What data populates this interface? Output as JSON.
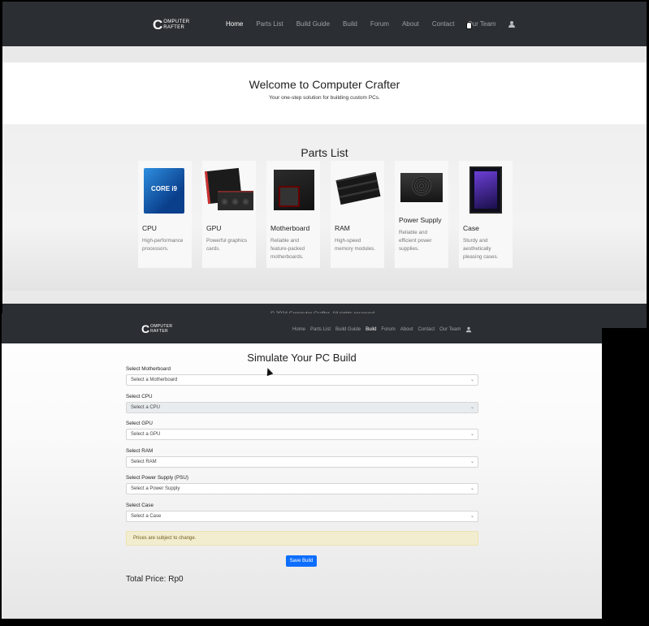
{
  "top": {
    "logo": {
      "big": "C",
      "line1": "OMPUTER",
      "line2": "RAFTER"
    },
    "nav": [
      "Home",
      "Parts List",
      "Build Guide",
      "Build",
      "Forum",
      "About",
      "Contact",
      "Our Team"
    ],
    "active": "Home",
    "hero": {
      "title": "Welcome to Computer Crafter",
      "subtitle": "Your one-step solution for building custom PCs."
    },
    "parts_title": "Parts List",
    "parts": [
      {
        "name": "CPU",
        "desc": "High-performance processors.",
        "icon": "cpu-box-icon"
      },
      {
        "name": "GPU",
        "desc": "Powerful graphics cards.",
        "icon": "gpu-icon"
      },
      {
        "name": "Motherboard",
        "desc": "Reliable and feature-packed motherboards.",
        "icon": "motherboard-icon"
      },
      {
        "name": "RAM",
        "desc": "High-speed memory modules.",
        "icon": "ram-icon"
      },
      {
        "name": "Power Supply",
        "desc": "Reliable and efficient power supplies.",
        "icon": "psu-icon"
      },
      {
        "name": "Case",
        "desc": "Sturdy and aesthetically pleasing cases.",
        "icon": "case-icon"
      }
    ],
    "cpu_label": "CORE i9",
    "footer": "© 2024 Computer Crafter. All rights reserved."
  },
  "bottom": {
    "logo": {
      "big": "C",
      "line1": "OMPUTER",
      "line2": "RAFTER"
    },
    "nav": [
      "Home",
      "Parts List",
      "Build Guide",
      "Build",
      "Forum",
      "About",
      "Contact",
      "Our Team"
    ],
    "active": "Build",
    "title": "Simulate Your PC Build",
    "fields": [
      {
        "label": "Select Motherboard",
        "placeholder": "Select a Motherboard",
        "disabled": false
      },
      {
        "label": "Select CPU",
        "placeholder": "Select a CPU",
        "disabled": true
      },
      {
        "label": "Select GPU",
        "placeholder": "Select a GPU",
        "disabled": false
      },
      {
        "label": "Select RAM",
        "placeholder": "Select RAM",
        "disabled": false
      },
      {
        "label": "Select Power Supply (PSU)",
        "placeholder": "Select a Power Supply",
        "disabled": false
      },
      {
        "label": "Select Case",
        "placeholder": "Select a Case",
        "disabled": false
      }
    ],
    "alert": "Prices are subject to change.",
    "save_label": "Save Build",
    "total": "Total Price: Rp0"
  },
  "colors": {
    "navbar": "#2b2e32",
    "primary": "#0d6efd",
    "alert_bg": "#f3edcf"
  }
}
